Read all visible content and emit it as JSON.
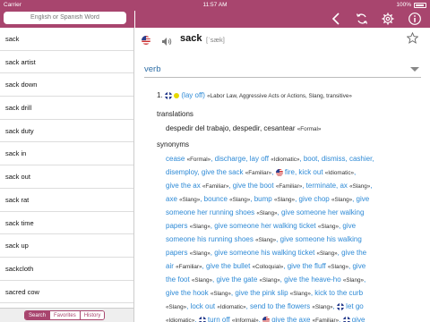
{
  "status": {
    "carrier": "Carrier",
    "time": "11:57 AM",
    "battery": "100%"
  },
  "search": {
    "placeholder": "English or Spanish Word"
  },
  "word_list": [
    "sack",
    "sack artist",
    "sack down",
    "sack drill",
    "sack duty",
    "sack in",
    "sack out",
    "sack rat",
    "sack time",
    "sack up",
    "sackcloth",
    "sacred cow"
  ],
  "bottom_tabs": [
    "Search",
    "Favorites",
    "History"
  ],
  "toolbar": {
    "icons": [
      "back-icon",
      "refresh-icon",
      "settings-icon",
      "info-icon"
    ]
  },
  "entry": {
    "headword": "sack",
    "pronunciation": "[ˈsæk]",
    "part_of_speech": "verb",
    "sense_number": "1.",
    "sense_term": "(lay off)",
    "sense_note": "«Labor Law, Aggressive Acts or Actions, Slang, transitive»",
    "translations_heading": "translations",
    "translations_text": "despedir del trabajo, despedir, cesantear",
    "translations_note": "«Formal»",
    "synonyms_heading": "synonyms"
  },
  "synonyms": [
    [
      [
        "l",
        "cease "
      ],
      [
        "n",
        "«Formal»"
      ],
      [
        "l",
        ", discharge, lay off "
      ],
      [
        "n",
        "«Idiomatic»"
      ],
      [
        "l",
        ", boot, dismiss, cashier,"
      ]
    ],
    [
      [
        "l",
        "disemploy, give the sack "
      ],
      [
        "n",
        "«Familiar»"
      ],
      [
        "l",
        ", "
      ],
      [
        "us",
        ""
      ],
      [
        "l",
        " fire, kick out "
      ],
      [
        "n",
        "«Idiomatic»"
      ],
      [
        "l",
        ","
      ]
    ],
    [
      [
        "l",
        "give the ax "
      ],
      [
        "n",
        "«Familiar»"
      ],
      [
        "l",
        ", give the boot "
      ],
      [
        "n",
        "«Familiar»"
      ],
      [
        "l",
        ", terminate, ax "
      ],
      [
        "n",
        "«Slang»"
      ],
      [
        "l",
        ","
      ]
    ],
    [
      [
        "l",
        "axe "
      ],
      [
        "n",
        "«Slang»"
      ],
      [
        "l",
        ", bounce "
      ],
      [
        "n",
        "«Slang»"
      ],
      [
        "l",
        ", bump "
      ],
      [
        "n",
        "«Slang»"
      ],
      [
        "l",
        ", give chop "
      ],
      [
        "n",
        "«Slang»"
      ],
      [
        "l",
        ", give"
      ]
    ],
    [
      [
        "l",
        "someone her running shoes "
      ],
      [
        "n",
        "«Slang»"
      ],
      [
        "l",
        ", give someone her walking"
      ]
    ],
    [
      [
        "l",
        "papers "
      ],
      [
        "n",
        "«Slang»"
      ],
      [
        "l",
        ", give someone her walking ticket "
      ],
      [
        "n",
        "«Slang»"
      ],
      [
        "l",
        ", give"
      ]
    ],
    [
      [
        "l",
        "someone his running shoes "
      ],
      [
        "n",
        "«Slang»"
      ],
      [
        "l",
        ", give someone his walking"
      ]
    ],
    [
      [
        "l",
        "papers "
      ],
      [
        "n",
        "«Slang»"
      ],
      [
        "l",
        ", give someone his walking ticket "
      ],
      [
        "n",
        "«Slang»"
      ],
      [
        "l",
        ", give the"
      ]
    ],
    [
      [
        "l",
        "air "
      ],
      [
        "n",
        "«Familiar»"
      ],
      [
        "l",
        ", give the bullet "
      ],
      [
        "n",
        "«Colloquial»"
      ],
      [
        "l",
        ", give the fluff "
      ],
      [
        "n",
        "«Slang»"
      ],
      [
        "l",
        ", give"
      ]
    ],
    [
      [
        "l",
        "the foot "
      ],
      [
        "n",
        "«Slang»"
      ],
      [
        "l",
        ", give the gate "
      ],
      [
        "n",
        "«Slang»"
      ],
      [
        "l",
        ", give the heave-ho "
      ],
      [
        "n",
        "«Slang»"
      ],
      [
        "l",
        ","
      ]
    ],
    [
      [
        "l",
        "give the hook "
      ],
      [
        "n",
        "«Slang»"
      ],
      [
        "l",
        ", give the pink slip "
      ],
      [
        "n",
        "«Slang»"
      ],
      [
        "l",
        ", kick to the curb"
      ]
    ],
    [
      [
        "n",
        "«Slang»"
      ],
      [
        "l",
        ", lock out "
      ],
      [
        "n",
        "«Idiomatic»"
      ],
      [
        "l",
        ", send to the flowers "
      ],
      [
        "n",
        "«Slang»"
      ],
      [
        "l",
        ", "
      ],
      [
        "uk",
        ""
      ],
      [
        "l",
        " let go"
      ]
    ],
    [
      [
        "n",
        "«Idiomatic»"
      ],
      [
        "l",
        ", "
      ],
      [
        "uk",
        ""
      ],
      [
        "l",
        " turn off "
      ],
      [
        "n",
        "«Informal»"
      ],
      [
        "l",
        ", "
      ],
      [
        "us",
        ""
      ],
      [
        "l",
        " give the axe "
      ],
      [
        "n",
        "«Familiar»"
      ],
      [
        "l",
        ", "
      ],
      [
        "uk",
        ""
      ],
      [
        "l",
        " give"
      ]
    ]
  ]
}
